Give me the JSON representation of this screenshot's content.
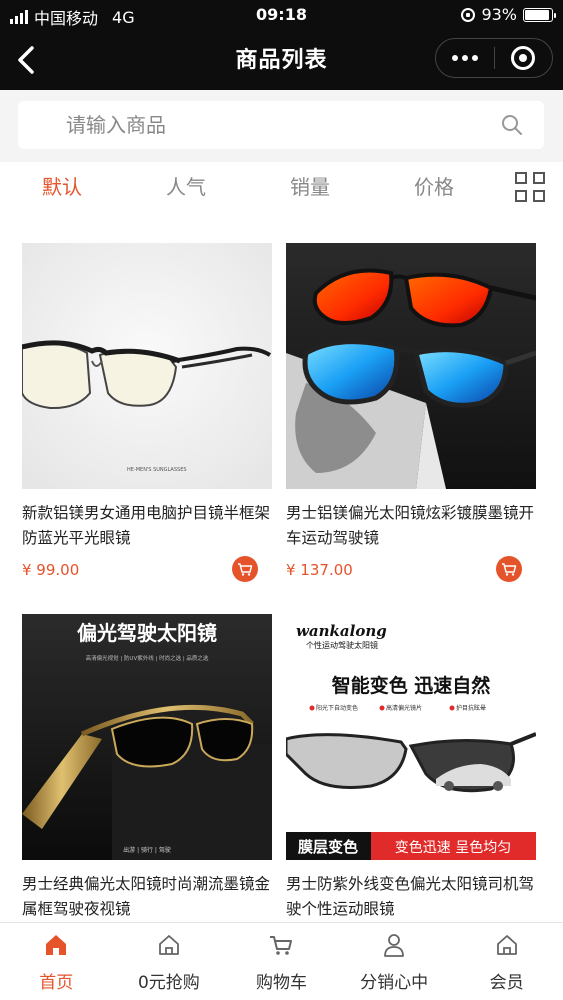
{
  "status_bar": {
    "carrier": "中国移动",
    "network": "4G",
    "time": "09:18",
    "battery": "93%",
    "battery_level": 0.93
  },
  "nav": {
    "title": "商品列表"
  },
  "search": {
    "placeholder": "请输入商品"
  },
  "sort_tabs": [
    {
      "label": "默认",
      "active": true
    },
    {
      "label": "人气",
      "active": false
    },
    {
      "label": "销量",
      "active": false
    },
    {
      "label": "价格",
      "active": false
    }
  ],
  "products": [
    {
      "name": "新款铝镁男女通用电脑护目镜半框架防蓝光平光眼镜",
      "price": "¥ 99.00",
      "image_text": "HE-MEN'S SUNGLASSES"
    },
    {
      "name": "男士铝镁偏光太阳镜炫彩镀膜墨镜开车运动驾驶镜",
      "price": "¥ 137.00"
    },
    {
      "name": "男士经典偏光太阳镜时尚潮流墨镜金属框驾驶夜视镜",
      "image_text": {
        "headline": "偏光驾驶太阳镜",
        "sub": "高清偏光视觉 | 防UV紫外线 | 时尚之选 | 品质之选",
        "foot": "出游 | 骑行 | 驾驶"
      }
    },
    {
      "name": "男士防紫外线变色偏光太阳镜司机驾驶个性运动眼镜",
      "image_text": {
        "brand": "wankalong",
        "brand_sub": "个性运动驾驶太阳镜",
        "headline": "智能变色 迅速自然",
        "features": [
          "阳光下自动变色",
          "高清偏光镜片",
          "护目抗眩晕"
        ],
        "band_left": "膜层变色",
        "band_right": "变色迅速 呈色均匀"
      }
    }
  ],
  "bottom_nav": [
    {
      "label": "首页",
      "icon": "home-icon",
      "active": true
    },
    {
      "label": "0元抢购",
      "icon": "home-outline-icon",
      "active": false
    },
    {
      "label": "购物车",
      "icon": "cart-icon",
      "active": false
    },
    {
      "label": "分销心中",
      "icon": "user-icon",
      "active": false
    },
    {
      "label": "会员",
      "icon": "home-outline-icon",
      "active": false
    }
  ],
  "colors": {
    "accent": "#e5532b",
    "topbar": "#0d0d0d"
  }
}
